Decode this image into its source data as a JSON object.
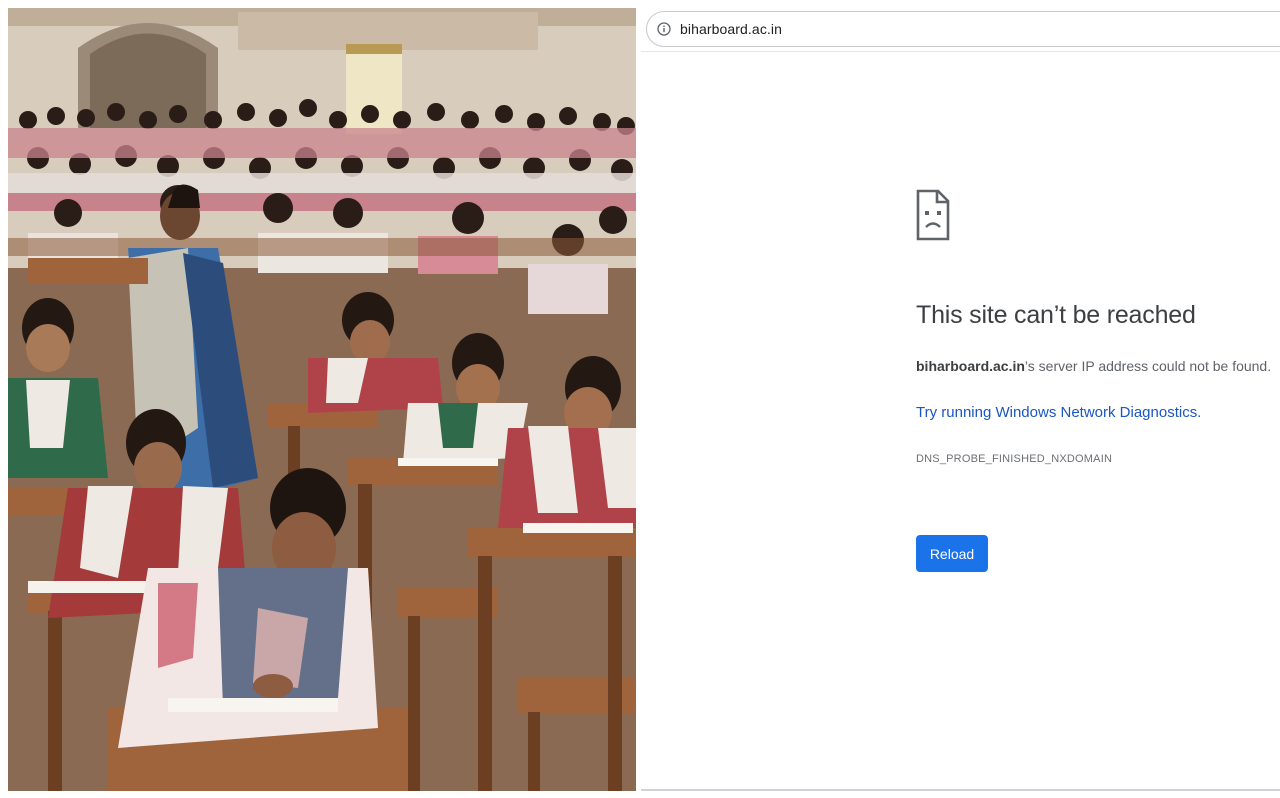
{
  "photo": {
    "subject": "exam-hall-photo"
  },
  "browser": {
    "url": "biharboard.ac.in",
    "icons": {
      "info": "info-icon",
      "error_page": "sad-document-icon"
    },
    "error": {
      "title": "This site can’t be reached",
      "domain": "biharboard.ac.in",
      "description_suffix": "’s server IP address could not be found.",
      "diagnostics_link": "Try running Windows Network Diagnostics.",
      "code": "DNS_PROBE_FINISHED_NXDOMAIN",
      "reload_label": "Reload"
    },
    "colors": {
      "accent": "#1a73e8",
      "link": "#1a56c4",
      "title": "#3c4043",
      "text": "#5f6368"
    }
  }
}
